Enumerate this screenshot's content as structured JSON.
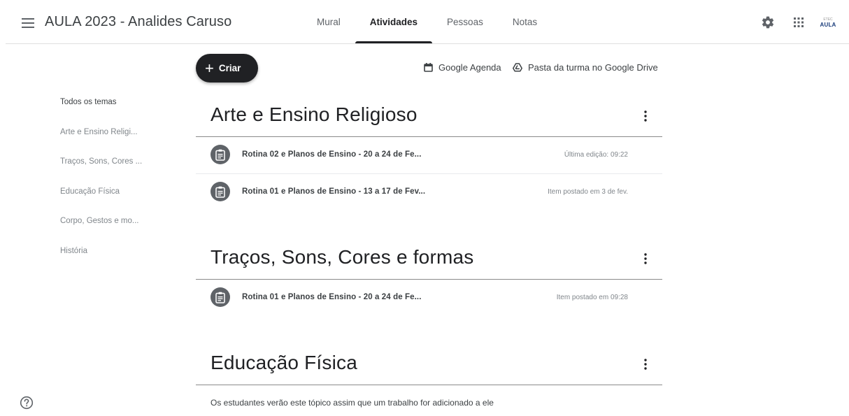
{
  "header": {
    "title": "AULA 2023 - Analides Caruso",
    "tabs": [
      {
        "label": "Mural"
      },
      {
        "label": "Atividades"
      },
      {
        "label": "Pessoas"
      },
      {
        "label": "Notas"
      }
    ],
    "active_tab": "Atividades",
    "logo": {
      "small_text": "ETEC",
      "text": "AULA"
    }
  },
  "toolbar": {
    "create_label": "Criar",
    "calendar_link": "Google Agenda",
    "drive_link": "Pasta da turma no Google Drive"
  },
  "sidebar": {
    "items": [
      {
        "label": "Todos os temas"
      },
      {
        "label": "Arte e Ensino Religi..."
      },
      {
        "label": "Traços, Sons, Cores ..."
      },
      {
        "label": "Educação Física"
      },
      {
        "label": "Corpo, Gestos e mo..."
      },
      {
        "label": "História"
      }
    ]
  },
  "topics": [
    {
      "title": "Arte e Ensino Religioso",
      "items": [
        {
          "title": "Rotina 02 e Planos de Ensino - 20 a 24 de Fe...",
          "meta": "Última edição: 09:22"
        },
        {
          "title": "Rotina 01 e Planos de Ensino - 13 a 17 de Fev...",
          "meta": "Item postado em 3 de fev."
        }
      ]
    },
    {
      "title": "Traços, Sons, Cores e formas",
      "items": [
        {
          "title": "Rotina 01 e Planos de Ensino - 20 a 24 de Fe...",
          "meta": "Item postado em 09:28"
        }
      ]
    },
    {
      "title": "Educação Física",
      "empty_message": "Os estudantes verão este tópico assim que um trabalho for adicionado a ele"
    }
  ],
  "colors": {
    "accent": "#202124",
    "icon_bg": "#5f6368",
    "divider": "#8a8a8a"
  }
}
